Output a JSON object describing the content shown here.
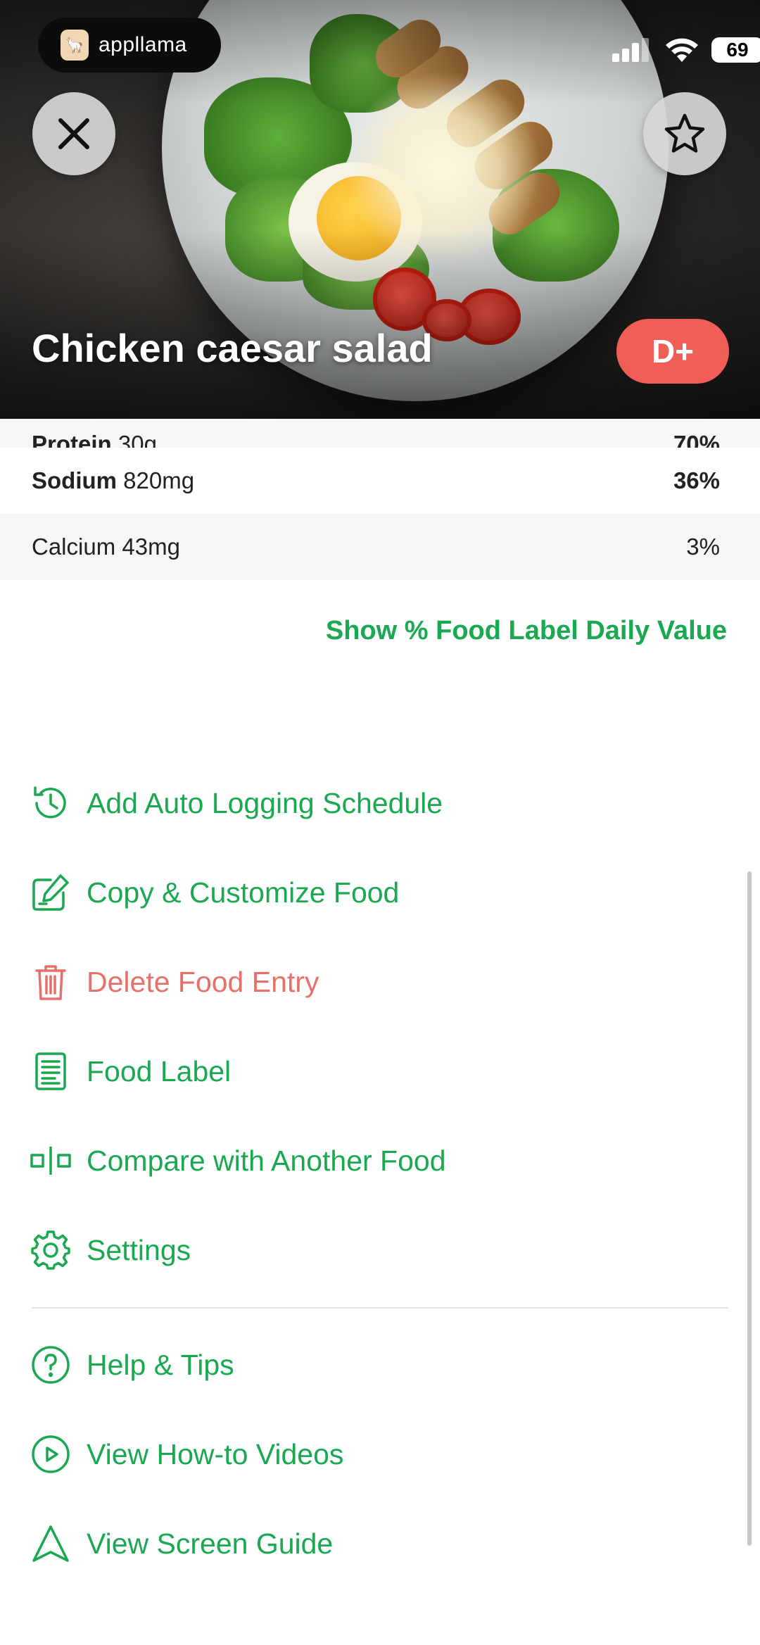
{
  "status_bar": {
    "app_badge": "appllama",
    "battery": "69"
  },
  "header": {
    "title": "Chicken caesar salad",
    "grade": "D+"
  },
  "nutrients": {
    "partial_row": {
      "name": "Protein",
      "amount": "30g",
      "pct": "70%"
    },
    "rows": [
      {
        "name": "Sodium",
        "amount": "820mg",
        "pct": "36%",
        "bold": true
      },
      {
        "name": "Calcium",
        "amount": "43mg",
        "pct": "3%",
        "bold": false
      }
    ]
  },
  "show_daily_value_link": "Show % Food Label Daily Value",
  "menu": {
    "items": [
      {
        "label": "Add Auto Logging Schedule",
        "icon": "history-clock-icon"
      },
      {
        "label": "Copy & Customize Food",
        "icon": "edit-icon"
      },
      {
        "label": "Delete Food Entry",
        "icon": "trash-icon"
      },
      {
        "label": "Food Label",
        "icon": "food-label-icon"
      },
      {
        "label": "Compare with Another Food",
        "icon": "compare-icon"
      },
      {
        "label": "Settings",
        "icon": "gear-icon"
      }
    ],
    "help_items": [
      {
        "label": "Help & Tips",
        "icon": "help-circle-icon"
      },
      {
        "label": "View How-to Videos",
        "icon": "play-circle-icon"
      },
      {
        "label": "View Screen Guide",
        "icon": "navigation-arrow-icon"
      }
    ]
  },
  "colors": {
    "accent_green": "#1aa850",
    "danger_red": "#e8706a",
    "grade_badge": "#ef5f58"
  }
}
